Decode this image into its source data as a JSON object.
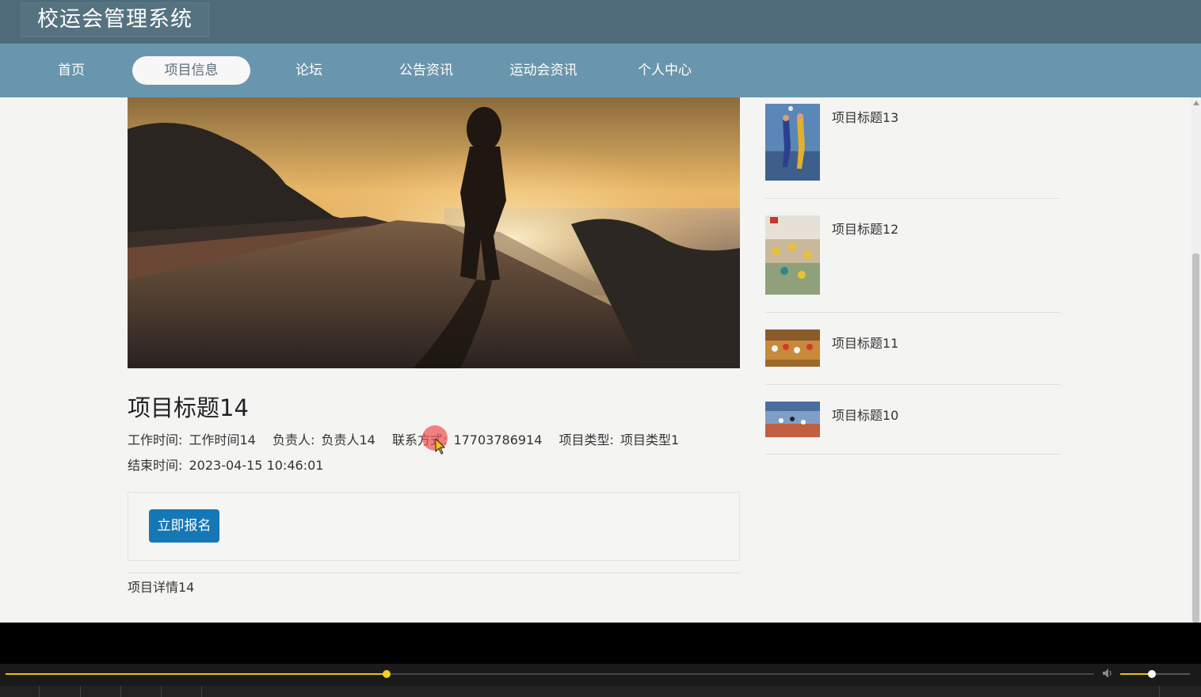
{
  "header": {
    "brand": "校运会管理系统"
  },
  "nav": {
    "items": [
      {
        "label": "首页",
        "active": false
      },
      {
        "label": "项目信息",
        "active": true
      },
      {
        "label": "论坛",
        "active": false
      },
      {
        "label": "公告资讯",
        "active": false
      },
      {
        "label": "运动会资讯",
        "active": false
      },
      {
        "label": "个人中心",
        "active": false
      }
    ]
  },
  "project": {
    "title": "项目标题14",
    "work_time_label": "工作时间:",
    "work_time_value": "工作时间14",
    "owner_label": "负责人:",
    "owner_value": "负责人14",
    "contact_label": "联系方式:",
    "contact_value": "17703786914",
    "type_label": "项目类型:",
    "type_value": "项目类型1",
    "end_time_label": "结束时间:",
    "end_time_value": "2023-04-15 10:46:01",
    "signup_button": "立即报名",
    "detail": "项目详情14"
  },
  "sidebar": {
    "items": [
      {
        "title": "项目标题13"
      },
      {
        "title": "项目标题12"
      },
      {
        "title": "项目标题11"
      },
      {
        "title": "项目标题10"
      }
    ]
  },
  "player": {
    "progress": 0.35,
    "volume": 0.45,
    "accent": "#e9c01a"
  },
  "colors": {
    "topbar": "#4f6b7a",
    "nav": "#6996ad",
    "button": "#1677b6"
  }
}
